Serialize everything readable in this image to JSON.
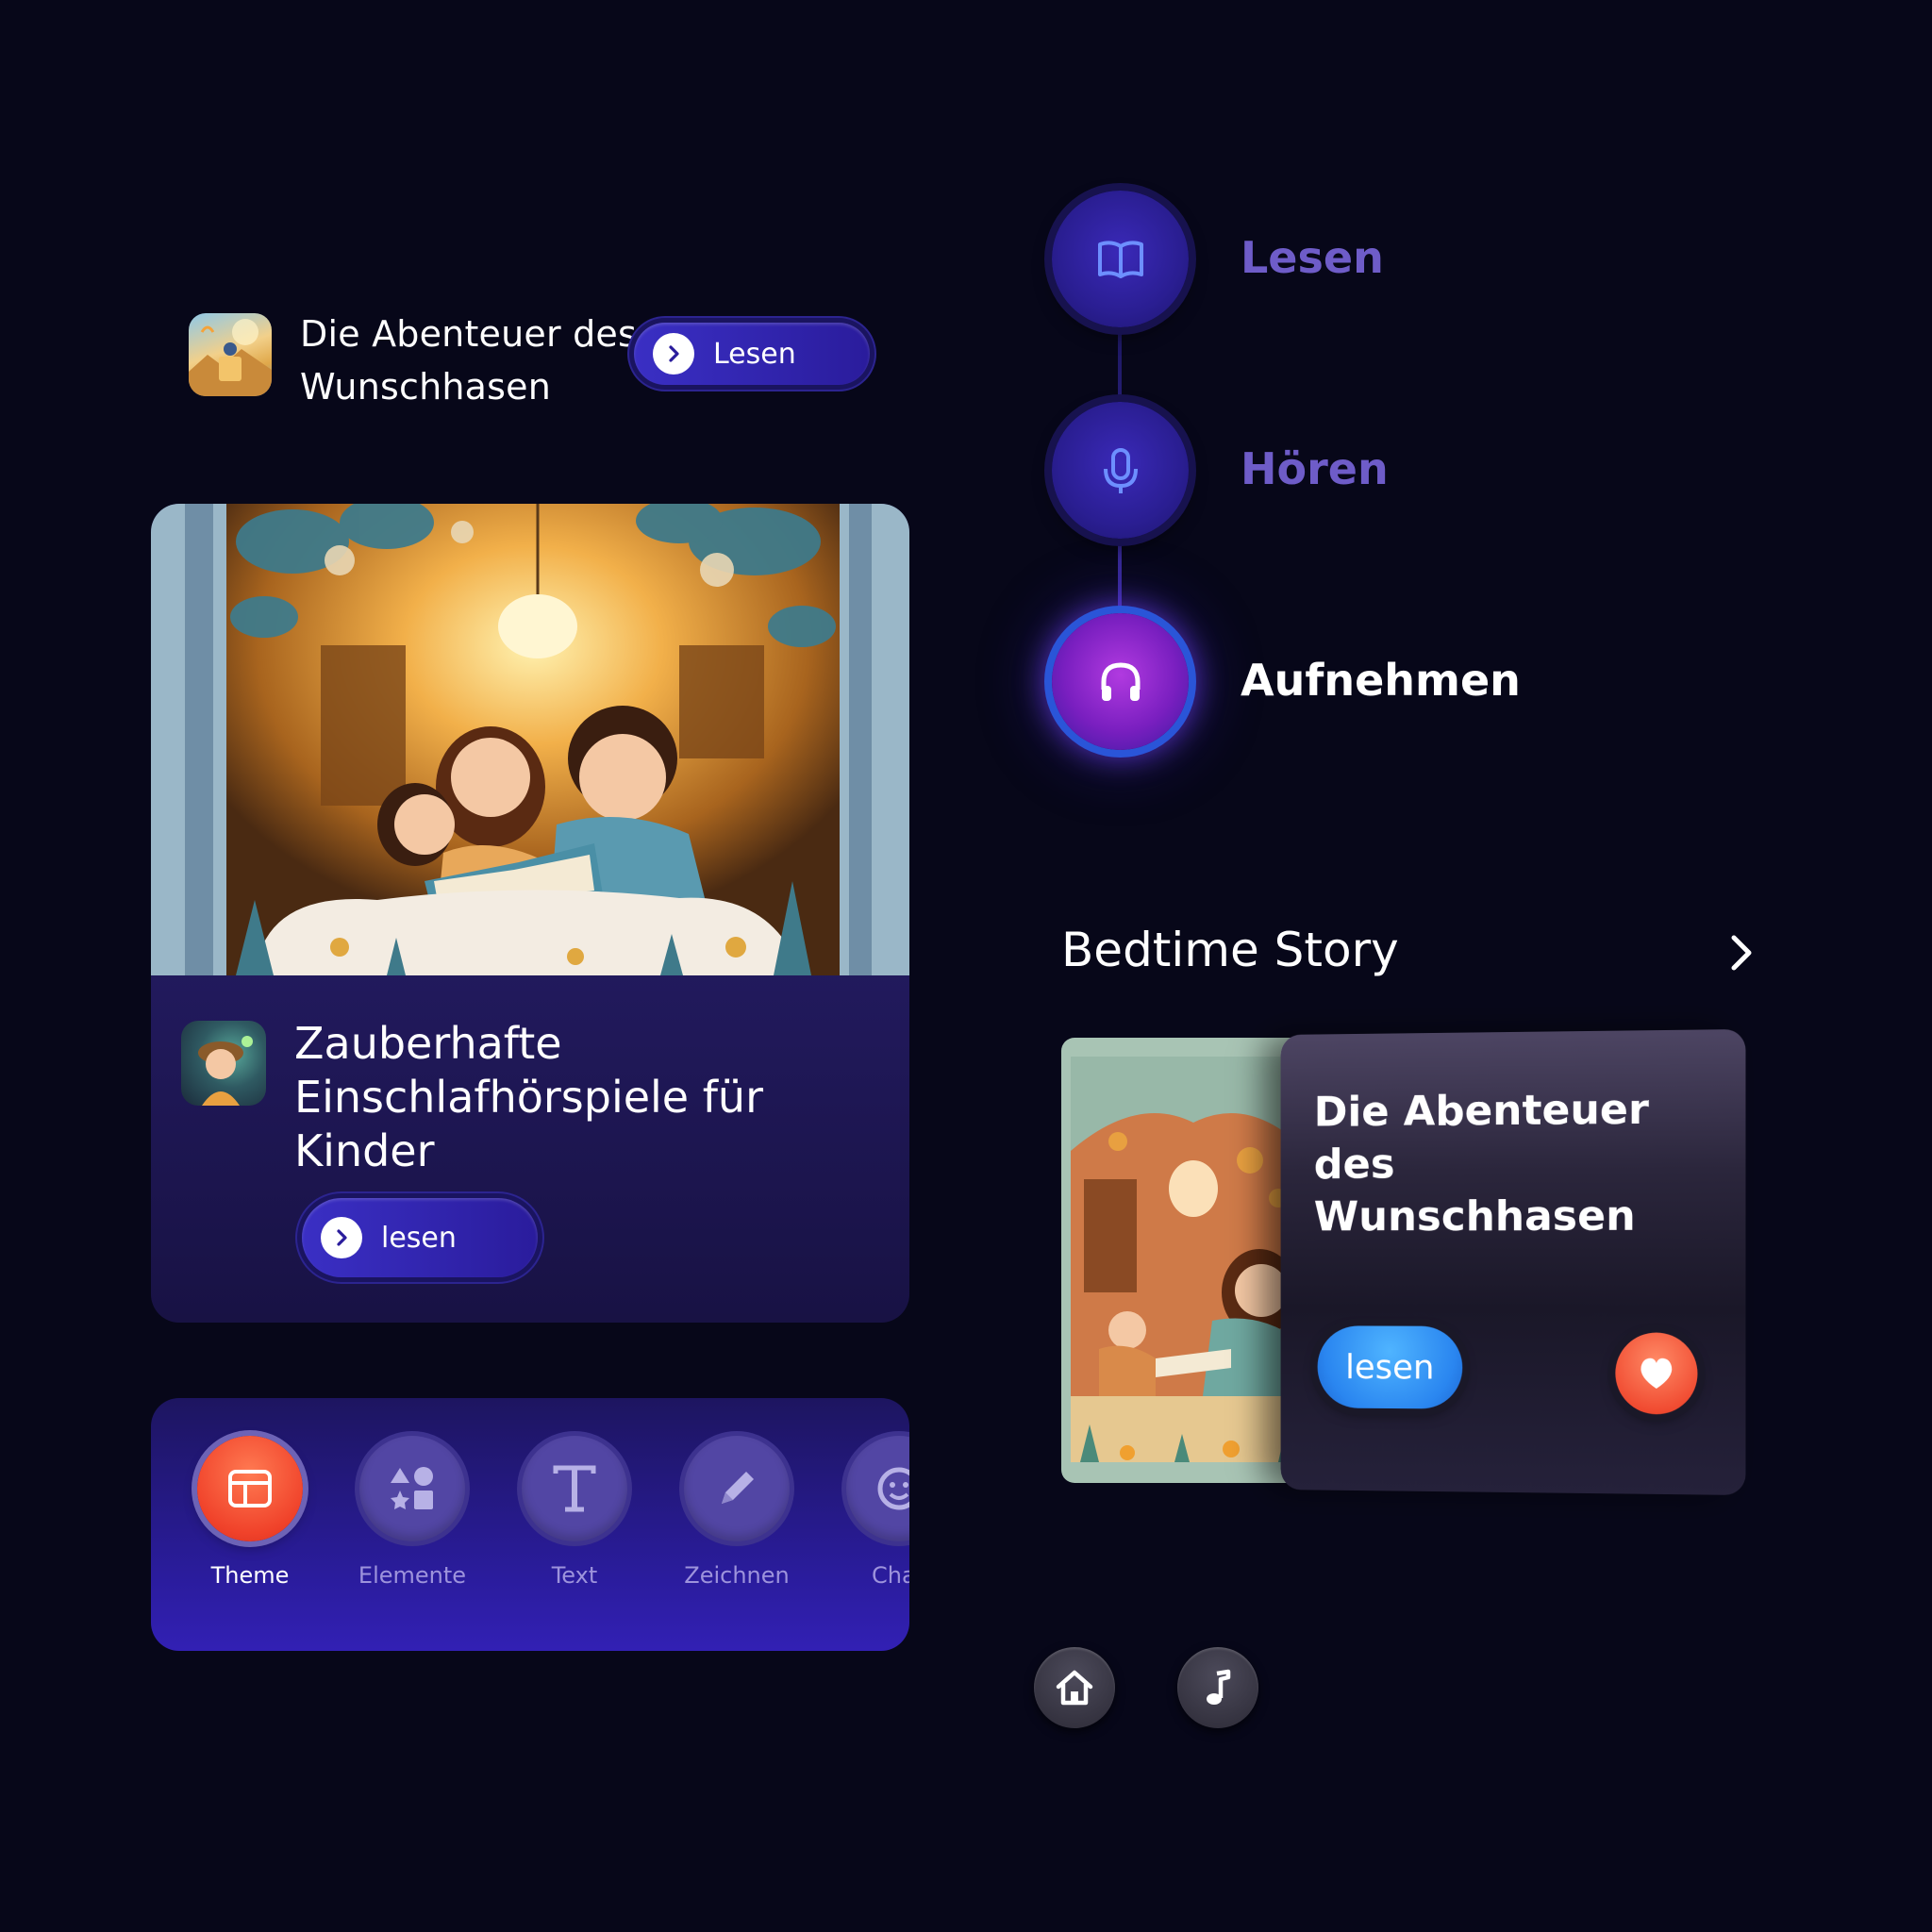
{
  "mini_story": {
    "title": "Die Abenteuer des Wunschhasen",
    "button_label": "Lesen"
  },
  "featured_card": {
    "title": "Zauberhafte Einschlafhörspiele für Kinder",
    "button_label": "lesen"
  },
  "toolbar": {
    "items": [
      {
        "label": "Theme",
        "icon": "theme-icon",
        "active": true
      },
      {
        "label": "Elemente",
        "icon": "elements-icon",
        "active": false
      },
      {
        "label": "Text",
        "icon": "text-icon",
        "active": false
      },
      {
        "label": "Zeichnen",
        "icon": "pencil-icon",
        "active": false
      },
      {
        "label": "Chara",
        "icon": "character-icon",
        "active": false
      }
    ]
  },
  "modes": {
    "items": [
      {
        "label": "Lesen",
        "icon": "book-icon",
        "active": false
      },
      {
        "label": "Hören",
        "icon": "microphone-icon",
        "active": false
      },
      {
        "label": "Aufnehmen",
        "icon": "headphones-icon",
        "active": true
      }
    ]
  },
  "bedtime": {
    "section_title": "Bedtime Story",
    "card_title": "Die Abenteuer des Wunschhasen",
    "read_label": "lesen"
  },
  "colors": {
    "background": "#070719",
    "accent_purple": "#2a1c9c",
    "active_orange": "#f0422a",
    "blue_button": "#2a86f0",
    "mode_label_inactive": "#6e5cc8"
  }
}
